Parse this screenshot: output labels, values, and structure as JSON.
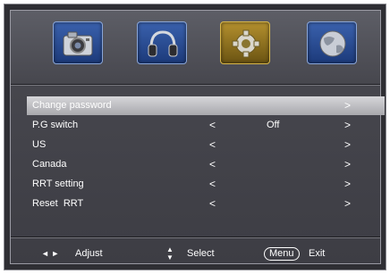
{
  "tabs": [
    {
      "icon": "camera-icon"
    },
    {
      "icon": "headphones-icon"
    },
    {
      "icon": "gear-icon"
    },
    {
      "icon": "globe-icon"
    }
  ],
  "menu": {
    "items": [
      {
        "label": "Change password",
        "left": "",
        "value": "",
        "right": ">"
      },
      {
        "label": "P.G switch",
        "left": "<",
        "value": "Off",
        "right": ">"
      },
      {
        "label": "US",
        "left": "<",
        "value": "",
        "right": ">"
      },
      {
        "label": "Canada",
        "left": "<",
        "value": "",
        "right": ">"
      },
      {
        "label": "RRT setting",
        "left": "<",
        "value": "",
        "right": ">"
      },
      {
        "label": "Reset  RRT",
        "left": "<",
        "value": "",
        "right": ">"
      }
    ]
  },
  "footer": {
    "adjust_arrows": "◄ ►",
    "adjust_label": "Adjust",
    "select_arrows": "▲\n▼",
    "select_label": "Select",
    "menu_key": "Menu",
    "exit_label": "Exit"
  },
  "colors": {
    "tab_blue": "#2a4d96",
    "tab_active_gold": "#a8852a",
    "highlight": "#c4c4c8"
  }
}
